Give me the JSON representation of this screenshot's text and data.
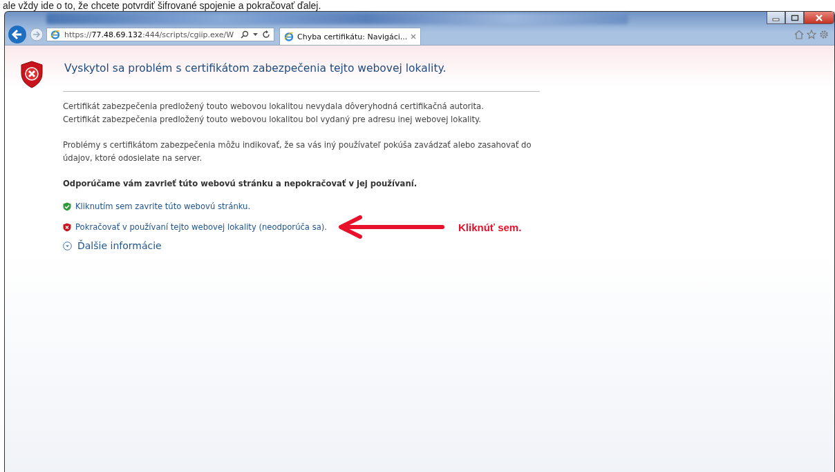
{
  "caption": "ale vždy ide o to, že chcete potvrdiť šifrované spojenie a pokračovať ďalej.",
  "address_bar": {
    "url": "https://**77.48.69.132**:444/scripts/cgiip.exe/W"
  },
  "tabs": [
    {
      "title": "Chyba certifikátu: Navigáci...",
      "selected": true
    }
  ],
  "page": {
    "heading": "Vyskytol sa problém s certifikátom zabezpečenia tejto webovej lokality.",
    "paragraphs": [
      [
        "Certifikát zabezpečenia predložený touto webovou lokalitou nevydala dôveryhodná certifikačná autorita.",
        "Certifikát zabezpečenia predložený touto webovou lokalitou bol vydaný pre adresu inej webovej lokality."
      ],
      [
        "Problémy s certifikátom zabezpečenia môžu indikovať, že sa vás iný používateľ pokúša zavádzať alebo zasahovať do údajov, ktoré odosielate na server."
      ]
    ],
    "recommendation": "Odporúčame vám zavrieť túto webovú stránku a nepokračovať v jej používaní.",
    "links": [
      {
        "kind": "safe",
        "label": "Kliknutím sem zavrite túto webovú stránku."
      },
      {
        "kind": "unsafe",
        "label": "Pokračovať v používaní tejto webovej lokality (neodporúča sa).",
        "annotation": "Kliknúť sem."
      }
    ],
    "more_info": {
      "label": "Ďalšie informácie",
      "expanded": false
    }
  }
}
